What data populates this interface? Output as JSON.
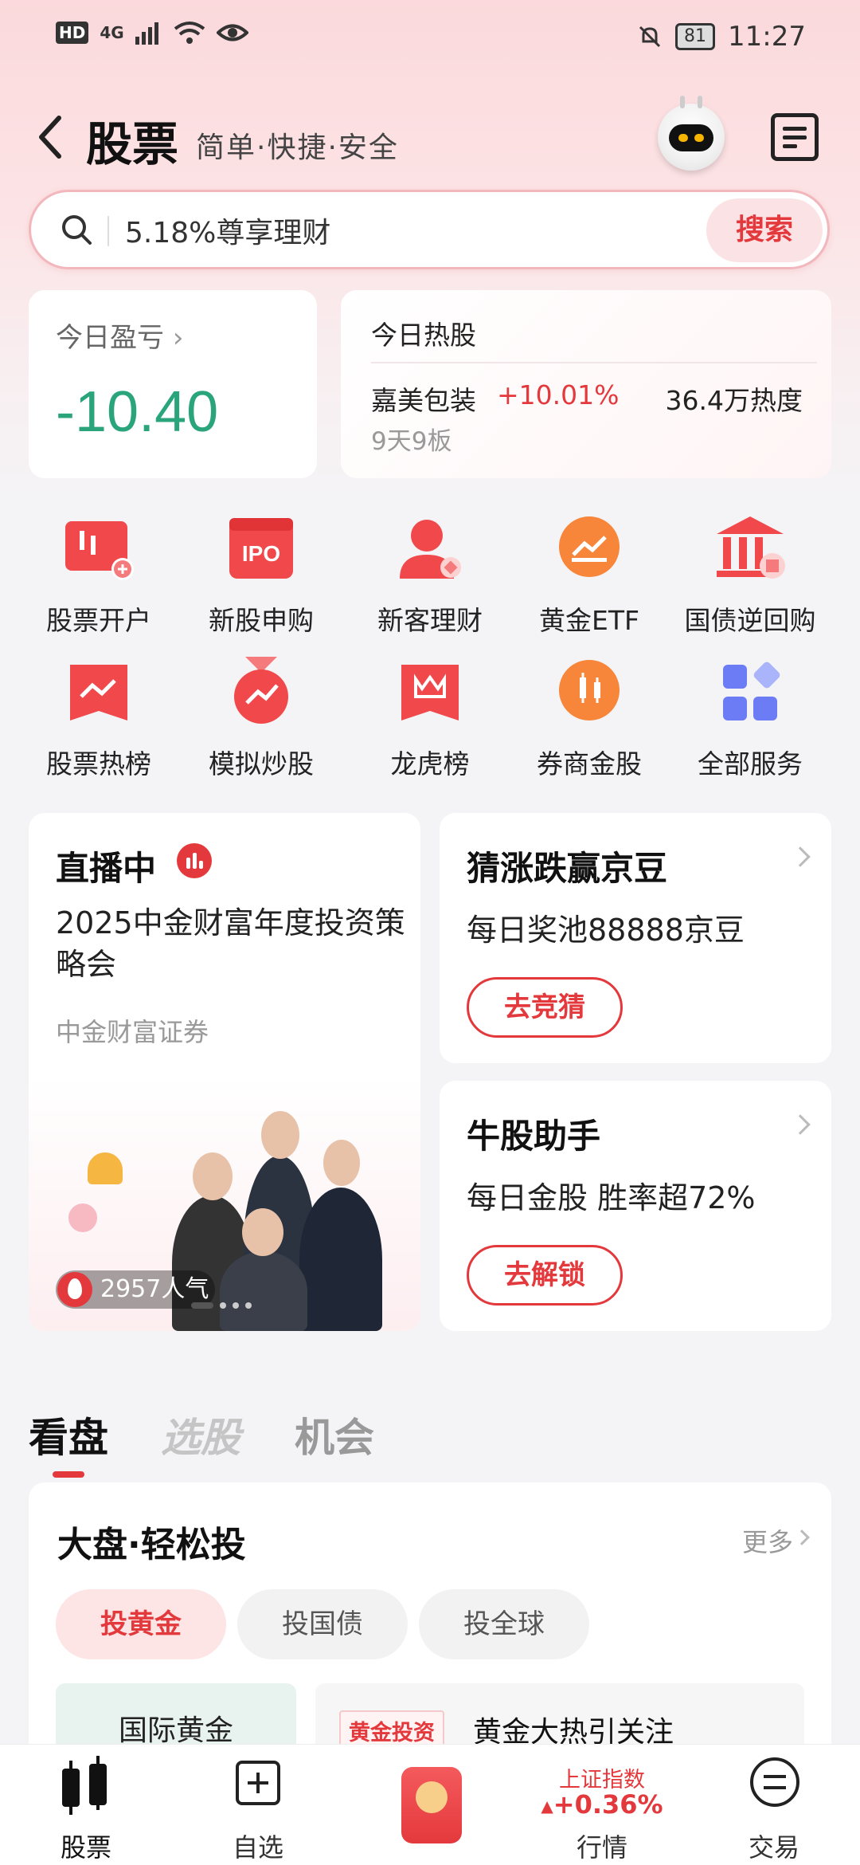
{
  "status_bar": {
    "network_badge": "HD",
    "network": "4G",
    "battery": "81",
    "time": "11:27"
  },
  "header": {
    "title": "股票",
    "subtitle": "简单·快捷·安全"
  },
  "search": {
    "placeholder": "5.18%尊享理财",
    "button": "搜索"
  },
  "pnl": {
    "label": "今日盈亏",
    "value": "-10.40"
  },
  "hot_stock": {
    "title": "今日热股",
    "name": "嘉美包装",
    "change": "+10.01%",
    "heat": "36.4万热度",
    "tag": "9天9板"
  },
  "services": [
    {
      "label": "股票开户",
      "icon": "account-open-icon"
    },
    {
      "label": "新股申购",
      "icon": "ipo-icon"
    },
    {
      "label": "新客理财",
      "icon": "new-client-icon"
    },
    {
      "label": "黄金ETF",
      "icon": "gold-etf-icon"
    },
    {
      "label": "国债逆回购",
      "icon": "bond-repo-icon"
    },
    {
      "label": "股票热榜",
      "icon": "hot-list-icon"
    },
    {
      "label": "模拟炒股",
      "icon": "simulation-icon"
    },
    {
      "label": "龙虎榜",
      "icon": "dragon-tiger-icon"
    },
    {
      "label": "券商金股",
      "icon": "broker-picks-icon"
    },
    {
      "label": "全部服务",
      "icon": "all-services-icon"
    }
  ],
  "live": {
    "title": "直播中",
    "desc": "2025中金财富年度投资策略会",
    "source": "中金财富证券",
    "popularity": "2957人气"
  },
  "promo_guess": {
    "title": "猜涨跌赢京豆",
    "subtitle": "每日奖池88888京豆",
    "button": "去竞猜"
  },
  "promo_bull": {
    "title": "牛股助手",
    "subtitle": "每日金股 胜率超72%",
    "button": "去解锁"
  },
  "tabs": [
    "看盘",
    "选股",
    "机会"
  ],
  "market": {
    "title": "大盘·轻松投",
    "more": "更多",
    "chips": [
      "投黄金",
      "投国债",
      "投全球"
    ],
    "sub_left": "国际黄金",
    "tag": "黄金投资",
    "headline": "黄金大热引关注"
  },
  "bottom_nav": {
    "stocks": "股票",
    "watchlist": "自选",
    "index_name": "上证指数",
    "index_change": "+0.36%",
    "market": "行情",
    "trade": "交易"
  },
  "colors": {
    "accent_red": "#e4393c",
    "loss_green": "#2aa57b"
  }
}
